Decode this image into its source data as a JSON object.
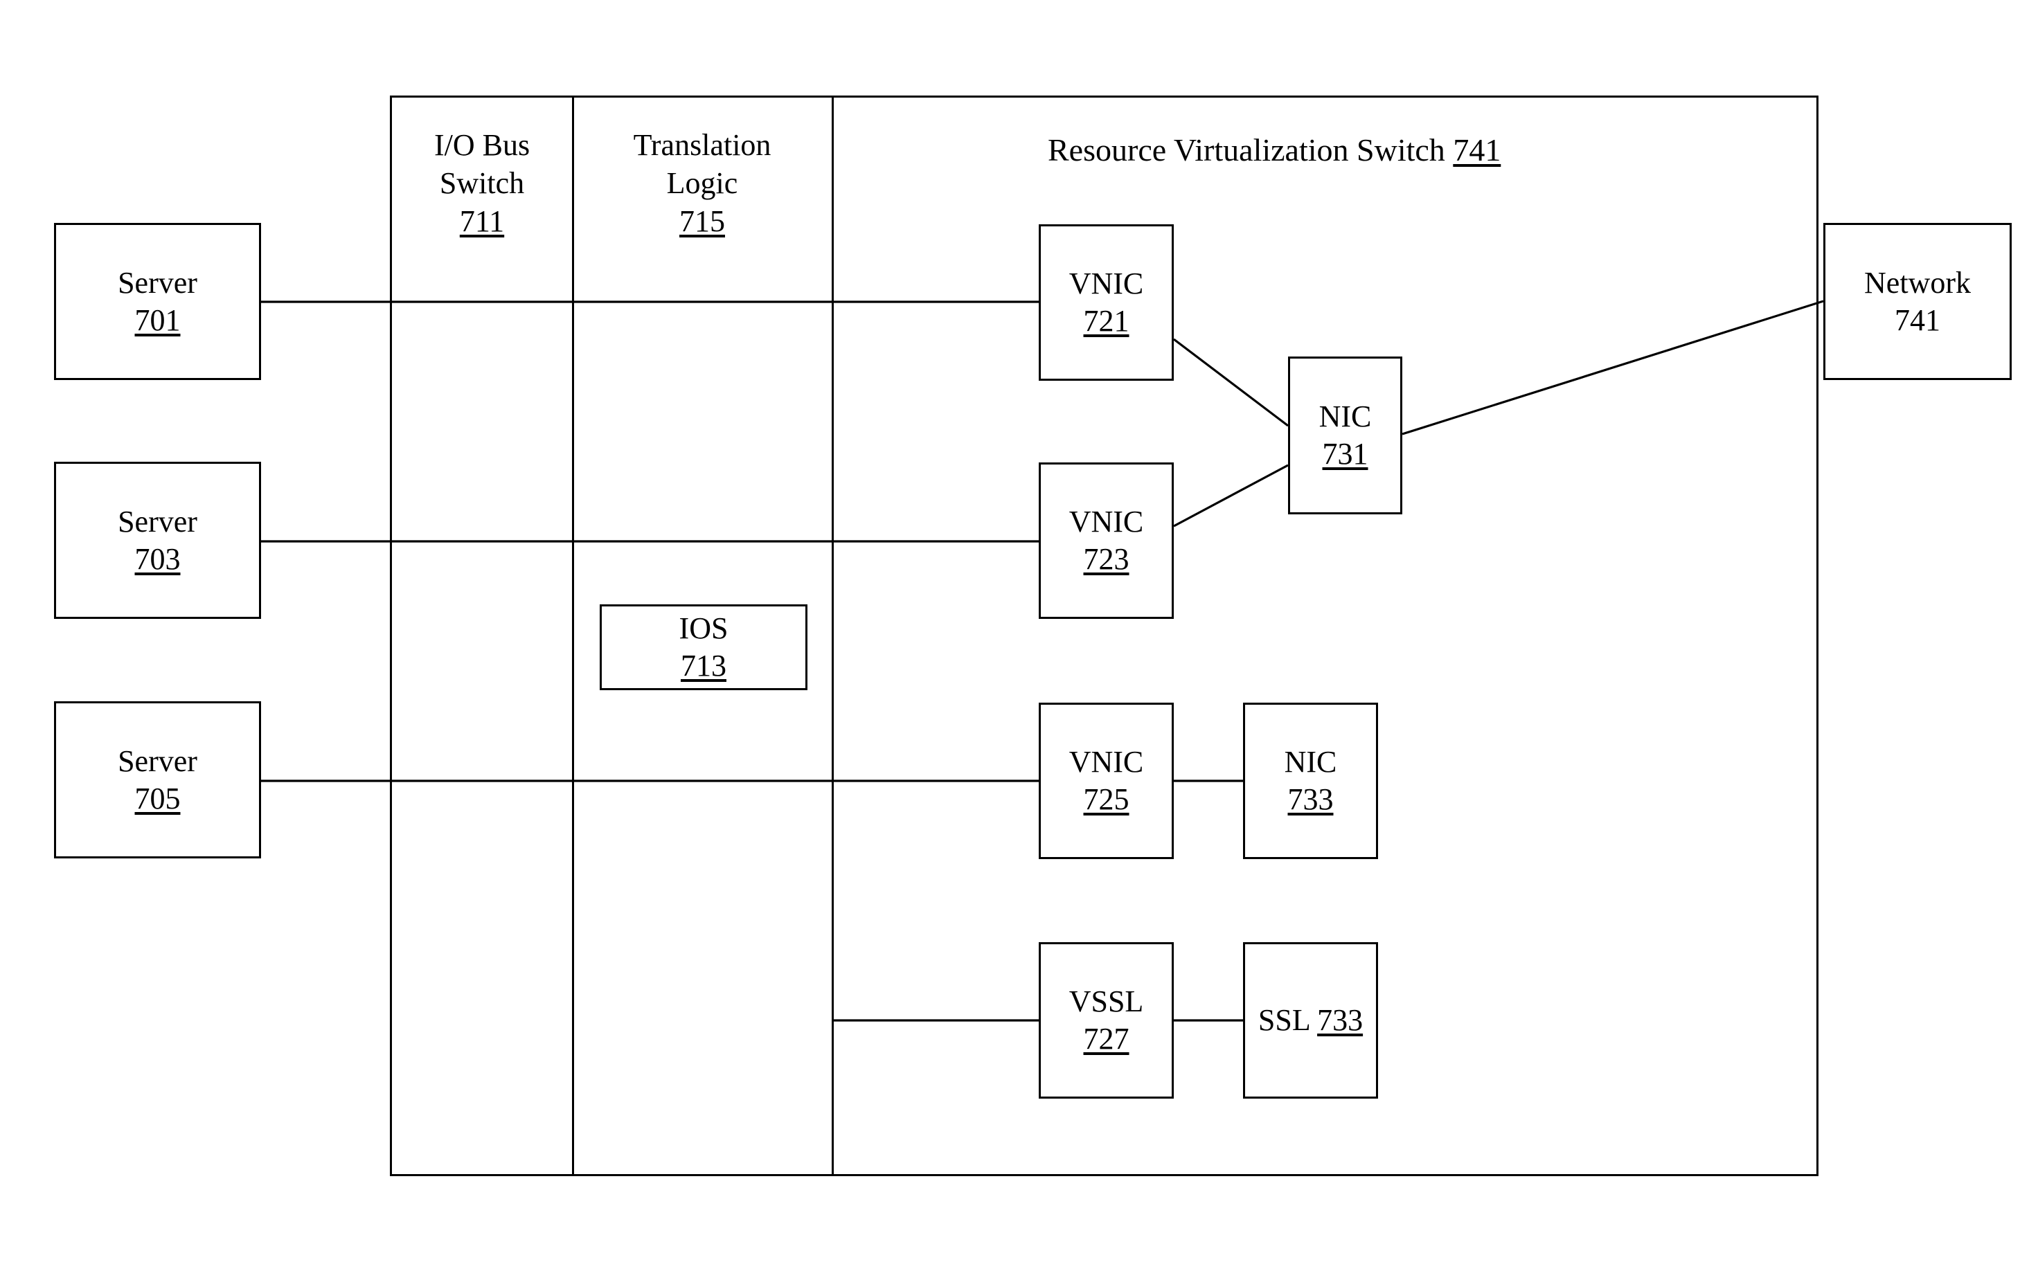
{
  "figure": {
    "type": "block-diagram",
    "title": "Resource Virtualization Switch"
  },
  "container": {
    "title_text": "Resource Virtualization Switch",
    "title_ref": "741"
  },
  "columns": [
    {
      "name": "io-bus-switch",
      "line1": "I/O Bus",
      "line2": "Switch",
      "ref": "711"
    },
    {
      "name": "translation-logic",
      "line1": "Translation",
      "line2": "Logic",
      "ref": "715"
    }
  ],
  "servers": [
    {
      "label": "Server",
      "ref": "701"
    },
    {
      "label": "Server",
      "ref": "703"
    },
    {
      "label": "Server",
      "ref": "705"
    }
  ],
  "ios": {
    "label": "IOS",
    "ref": "713"
  },
  "vnics": [
    {
      "label": "VNIC",
      "ref": "721"
    },
    {
      "label": "VNIC",
      "ref": "723"
    },
    {
      "label": "VNIC",
      "ref": "725"
    }
  ],
  "vssl": {
    "label": "VSSL",
    "ref": "727"
  },
  "nics": [
    {
      "label": "NIC",
      "ref": "731"
    },
    {
      "label": "NIC",
      "ref": "733"
    }
  ],
  "ssl": {
    "label": "SSL",
    "ref": "733"
  },
  "network": {
    "label": "Network",
    "ref": "741"
  },
  "connections": [
    {
      "from": "server-701",
      "to": "vnic-721",
      "style": "straight"
    },
    {
      "from": "server-703",
      "to": "vnic-723",
      "style": "straight"
    },
    {
      "from": "server-705",
      "to": "vnic-725",
      "style": "straight"
    },
    {
      "from": "translation-logic",
      "to": "vssl-727",
      "style": "straight"
    },
    {
      "from": "vnic-721",
      "to": "nic-731",
      "style": "diagonal"
    },
    {
      "from": "vnic-723",
      "to": "nic-731",
      "style": "diagonal"
    },
    {
      "from": "vnic-725",
      "to": "nic-733",
      "style": "straight"
    },
    {
      "from": "vssl-727",
      "to": "ssl-733",
      "style": "straight"
    },
    {
      "from": "nic-731",
      "to": "network-741",
      "style": "diagonal"
    }
  ]
}
